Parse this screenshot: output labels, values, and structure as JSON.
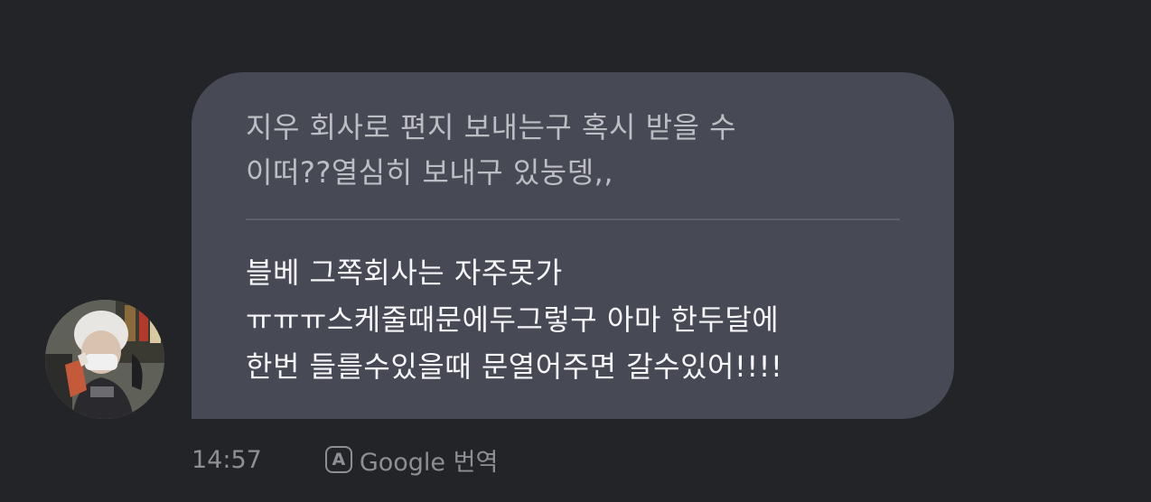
{
  "message": {
    "quoted_lines": [
      "지우 회사로 편지 보내는구 혹시 받을 수",
      "이떠??열심히 보내구 있눙뎅,,"
    ],
    "reply_lines": [
      "블베 그쪽회사는 자주못가",
      "ㅠㅠㅠ스케줄때문에두그렇구 아마 한두달에",
      "한번 들를수있을때 문열어주면 갈수있어!!!!"
    ],
    "time": "14:57",
    "translate_icon_letter": "A",
    "translate_label": "Google 번역"
  },
  "icons": {
    "avatar": "profile-photo",
    "translate": "translate-icon"
  },
  "colors": {
    "background": "#232427",
    "bubble": "#474955",
    "quoted_text": "#bdbec4",
    "reply_text": "#f6f6f8",
    "meta_text": "#8e8f95"
  }
}
